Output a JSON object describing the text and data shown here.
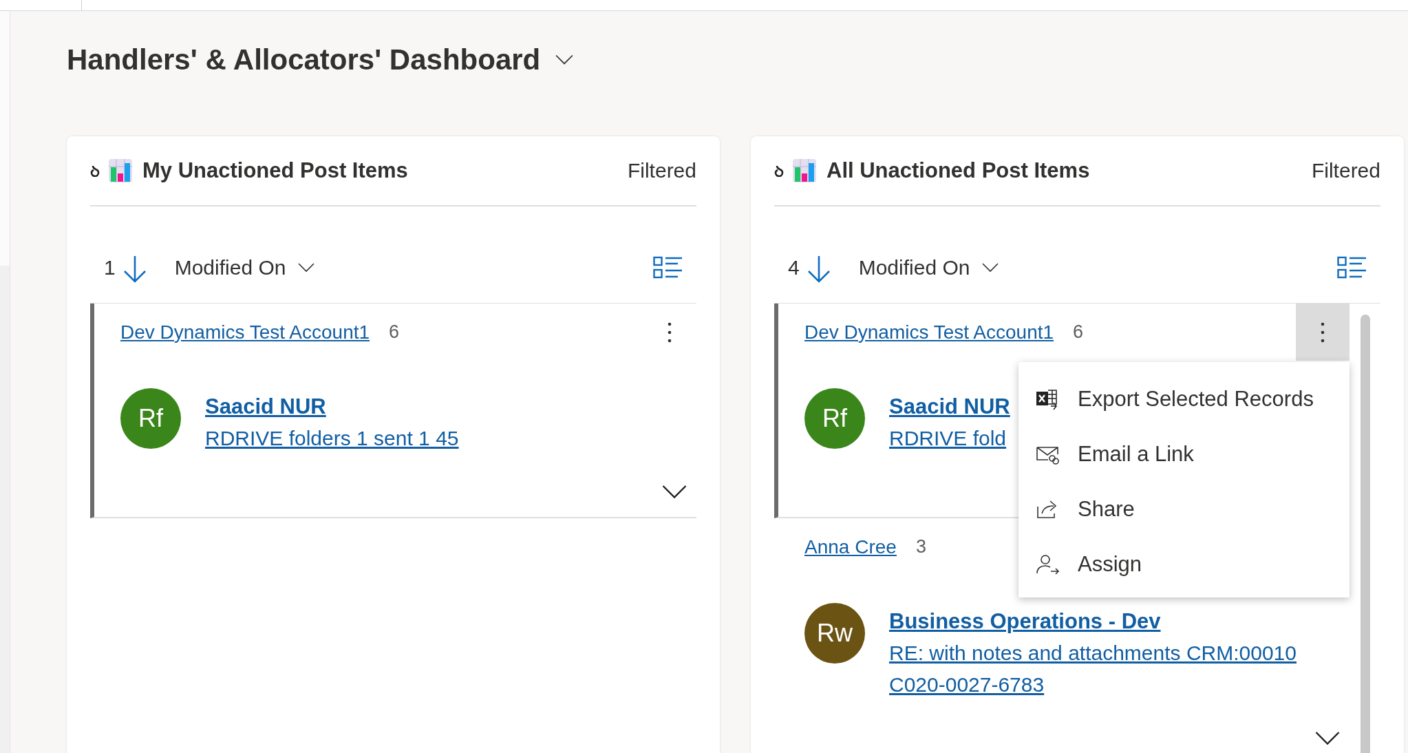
{
  "dashboard": {
    "title": "Handlers' & Allocators' Dashboard"
  },
  "panels": [
    {
      "title": "My Unactioned Post Items",
      "filter_status": "Filtered",
      "sort": {
        "count": "1",
        "field": "Modified On"
      },
      "scrollbar": false,
      "records": [
        {
          "account": "Dev Dynamics Test Account1",
          "count": "6",
          "initials": "Rf",
          "color": "#3a861b",
          "name": "Saacid NUR",
          "subject": "RDRIVE folders 1 sent 1 45",
          "selected": true,
          "menu_open": false
        }
      ]
    },
    {
      "title": "All Unactioned Post Items",
      "filter_status": "Filtered",
      "sort": {
        "count": "4",
        "field": "Modified On"
      },
      "scrollbar": true,
      "records": [
        {
          "account": "Dev Dynamics Test Account1",
          "count": "6",
          "initials": "Rf",
          "color": "#3a861b",
          "name": "Saacid NUR",
          "subject": "RDRIVE fold",
          "selected": true,
          "menu_open": true,
          "menu": [
            {
              "kind": "export",
              "label": "Export Selected Records"
            },
            {
              "kind": "email",
              "label": "Email a Link"
            },
            {
              "kind": "share",
              "label": "Share"
            },
            {
              "kind": "assign",
              "label": "Assign"
            }
          ]
        },
        {
          "account": "Anna Cree",
          "count": "3",
          "initials": "Rw",
          "color": "#6b5314",
          "name": "Business Operations - Dev",
          "subject": "RE: with notes and attachments CRM:00010 C020-0027-6783",
          "selected": false
        }
      ]
    }
  ]
}
